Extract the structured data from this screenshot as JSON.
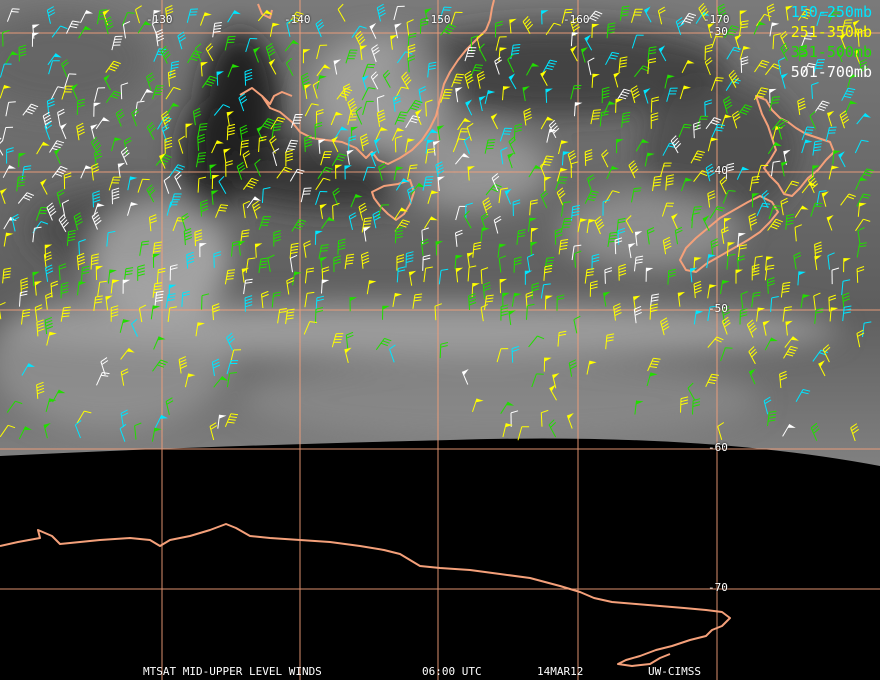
{
  "longitude_labels": [
    "-130",
    "-140",
    "-150",
    "-160",
    "-170"
  ],
  "latitude_labels": [
    "-30",
    "-40",
    "-50",
    "-60",
    "-70"
  ],
  "legend": [
    {
      "label": "150-250mb",
      "color": "#00e5ff"
    },
    {
      "label": "251-350mb",
      "color": "#ffff00"
    },
    {
      "label": "351-500mb",
      "color": "#22dd00"
    },
    {
      "label": "501-700mb",
      "color": "#ffffff"
    }
  ],
  "footer": {
    "product": "MTSAT MID-UPPER LEVEL WINDS",
    "time": "06:00 UTC",
    "date": "14MAR12",
    "source": "UW-CIMSS"
  },
  "colors": {
    "gridline": "#f4a07a",
    "coastline": "#f4a07a",
    "background": "#000000"
  }
}
